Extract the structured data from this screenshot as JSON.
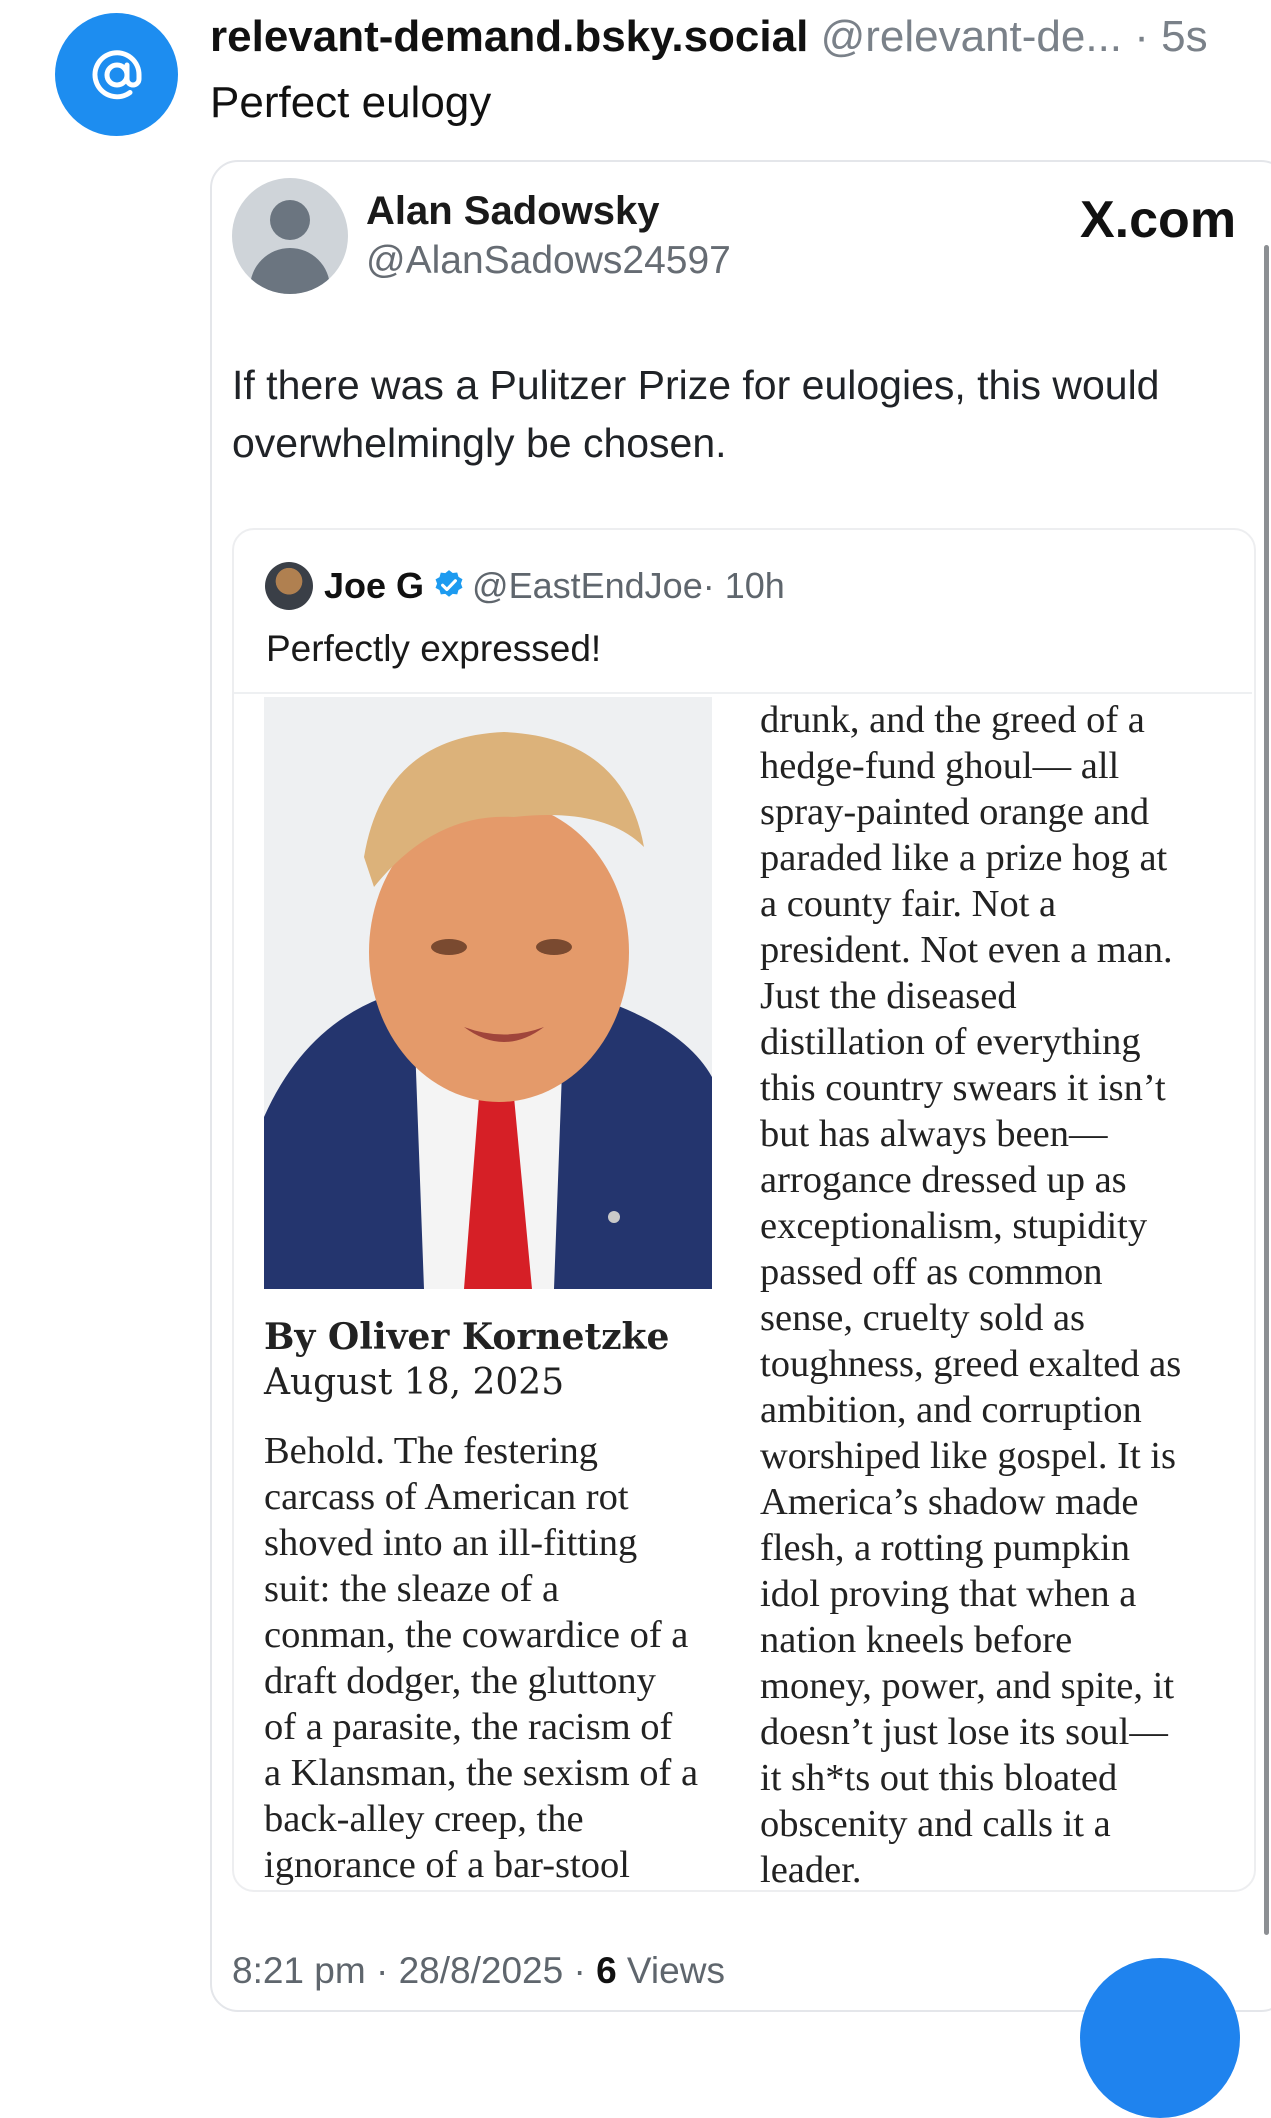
{
  "post": {
    "display_name": "relevant-demand.bsky.social",
    "handle": "@relevant-de...",
    "time": "· 5s",
    "text": "Perfect eulogy"
  },
  "embed": {
    "x_post": {
      "name": "Alan Sadowsky",
      "handle": "@AlanSadows24597",
      "source": "X.com",
      "text": "If there was a Pulitzer Prize for eulogies, this would overwhelmingly be chosen."
    },
    "quote": {
      "name": "Joe G",
      "handle": "@EastEndJoe",
      "time": "· 10h",
      "text": "Perfectly expressed!",
      "article": {
        "byline": "By Oliver Kornetzke",
        "date": "August 18, 2025",
        "left_lines": [
          "Behold. The festering",
          "carcass of American rot",
          "shoved into an ill-fitting",
          "suit: the sleaze of a",
          "conman, the cowardice of a",
          "draft dodger, the gluttony",
          "of a parasite, the racism of",
          "a Klansman, the sexism of a",
          "back-alley creep, the",
          "ignorance of a bar-stool"
        ],
        "right_lines": [
          "drunk, and the greed of a",
          "hedge-fund ghoul— all",
          "spray-painted orange and",
          "paraded like a prize hog at",
          "a county fair. Not a",
          "president. Not even a man.",
          "Just the diseased",
          "distillation of everything",
          "this country swears it isn’t",
          "but has always been—",
          "arrogance dressed up as",
          "exceptionalism, stupidity",
          "passed off as common",
          "sense, cruelty sold as",
          "toughness, greed exalted as",
          "ambition, and corruption",
          "worshiped like gospel. It is",
          "America’s shadow made",
          "flesh, a rotting pumpkin",
          "idol proving that when a",
          "nation kneels before",
          "money, power, and spite, it",
          "doesn’t just lose its soul—",
          "it sh*ts out this bloated",
          "obscenity and calls it a",
          "leader."
        ]
      }
    },
    "footer": {
      "timestamp": "8:21 pm · 28/8/2025 · ",
      "views_count": "6",
      "views_label": " Views"
    }
  },
  "icons": {
    "app_avatar": "at-sign-icon",
    "x_avatar": "default-profile-icon",
    "verified": "verified-badge-icon",
    "quote_avatar": "user-avatar",
    "fab": "compose-button"
  },
  "colors": {
    "bluesky_blue": "#1d8df0",
    "verified_blue": "#1d9bf0",
    "muted_text": "#7a8189"
  }
}
